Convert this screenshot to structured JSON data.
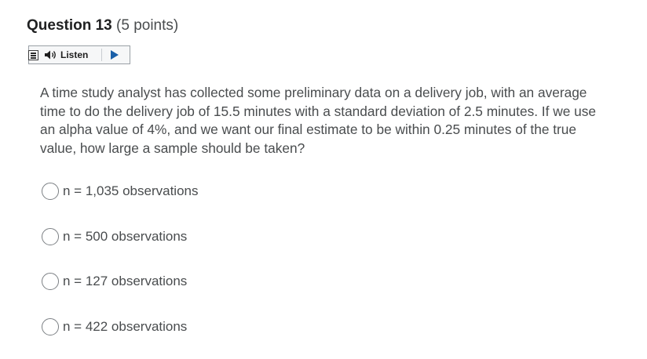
{
  "question": {
    "title": "Question 13",
    "points": "(5 points)",
    "text": "A time study analyst has collected some preliminary data on a delivery job, with an average time to do the delivery job of 15.5 minutes with a standard deviation of 2.5 minutes. If we use an alpha value of 4%, and we want our final estimate to be within 0.25 minutes of the true value, how large a sample should be taken?"
  },
  "listen": {
    "label": "Listen",
    "menu_icon": "menu-icon",
    "speaker_icon": "speaker-icon",
    "play_icon": "play-icon",
    "accent_color": "#1a5fa8"
  },
  "options": [
    {
      "label": "n = 1,035 observations",
      "selected": false
    },
    {
      "label": "n = 500 observations",
      "selected": false
    },
    {
      "label": "n = 127 observations",
      "selected": false
    },
    {
      "label": "n = 422 observations",
      "selected": false
    }
  ]
}
